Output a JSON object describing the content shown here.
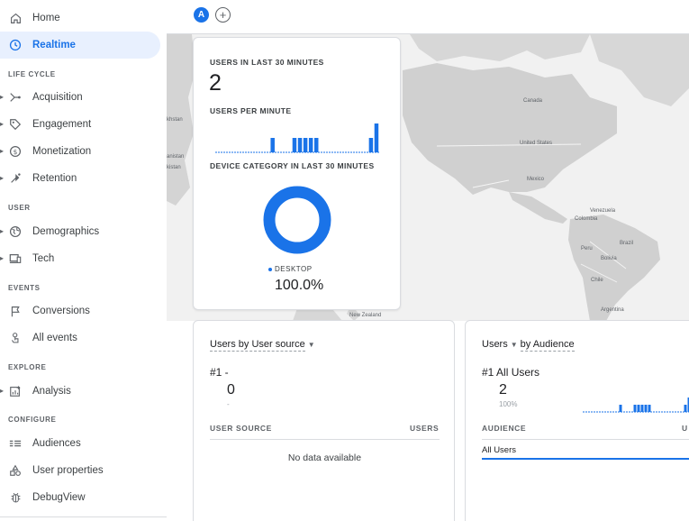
{
  "sidebar": {
    "home": "Home",
    "realtime": "Realtime",
    "sections": {
      "lifecycle": "LIFE CYCLE",
      "user": "USER",
      "events": "EVENTS",
      "explore": "EXPLORE",
      "configure": "CONFIGURE"
    },
    "acquisition": "Acquisition",
    "engagement": "Engagement",
    "monetization": "Monetization",
    "retention": "Retention",
    "demographics": "Demographics",
    "tech": "Tech",
    "conversions": "Conversions",
    "all_events": "All events",
    "analysis": "Analysis",
    "audiences": "Audiences",
    "user_properties": "User properties",
    "debugview": "DebugView"
  },
  "topbar": {
    "comparison_avatar": "A",
    "add_comparison": "+"
  },
  "map": {
    "labels": {
      "canada": "Canada",
      "united_states": "United States",
      "mexico": "Mexico",
      "venezuela": "Venezuela",
      "colombia": "Colombia",
      "peru": "Peru",
      "brazil": "Brazil",
      "bolivia": "Bolivia",
      "chile": "Chile",
      "argentina": "Argentina",
      "new_zealand": "New Zealand",
      "khstan": "khstan",
      "anistan": "anistan",
      "kistan": "kistan"
    }
  },
  "realtime_card": {
    "users_label": "USERS IN LAST 30 MINUTES",
    "users_value": "2",
    "per_minute_label": "USERS PER MINUTE",
    "device_label": "DEVICE CATEGORY IN LAST 30 MINUTES",
    "legend_label": "DESKTOP",
    "legend_value": "100.0%",
    "colors": {
      "accent": "#1a73e8"
    }
  },
  "chart_data": [
    {
      "type": "bar",
      "title": "USERS PER MINUTE",
      "categories": [
        1,
        2,
        3,
        4,
        5,
        6,
        7,
        8,
        9,
        10,
        11,
        12,
        13,
        14,
        15,
        16,
        17,
        18,
        19,
        20,
        21,
        22,
        23,
        24,
        25,
        26,
        27,
        28,
        29,
        30
      ],
      "values": [
        0,
        0,
        0,
        0,
        0,
        0,
        0,
        0,
        0,
        0,
        1,
        0,
        0,
        0,
        1,
        1,
        1,
        1,
        1,
        0,
        0,
        0,
        0,
        0,
        0,
        0,
        0,
        0,
        1,
        2
      ],
      "ylim": [
        0,
        2
      ]
    },
    {
      "type": "pie",
      "title": "DEVICE CATEGORY IN LAST 30 MINUTES",
      "categories": [
        "DESKTOP"
      ],
      "values": [
        100.0
      ]
    },
    {
      "type": "bar",
      "categories": [
        1,
        2,
        3,
        4,
        5,
        6,
        7,
        8,
        9,
        10,
        11,
        12,
        13,
        14,
        15,
        16,
        17,
        18,
        19,
        20,
        21,
        22,
        23,
        24,
        25,
        26,
        27,
        28,
        29,
        30
      ],
      "values": [
        0,
        0,
        0,
        0,
        0,
        0,
        0,
        0,
        0,
        0,
        1,
        0,
        0,
        0,
        1,
        1,
        1,
        1,
        1,
        0,
        0,
        0,
        0,
        0,
        0,
        0,
        0,
        0,
        1,
        2
      ],
      "ylim": [
        0,
        2
      ]
    }
  ],
  "source_card": {
    "title_dimension": "Users by User source",
    "rank_label": "#1  -",
    "rank_value": "0",
    "rank_sub": "-",
    "col_source": "USER SOURCE",
    "col_users": "USERS",
    "empty": "No data available"
  },
  "audience_card": {
    "title_prefix": "Users",
    "title_dimension": "by Audience",
    "rank_label": "#1  All Users",
    "rank_value": "2",
    "rank_sub": "100%",
    "col_audience": "AUDIENCE",
    "col_users": "U",
    "row_label": "All Users"
  }
}
